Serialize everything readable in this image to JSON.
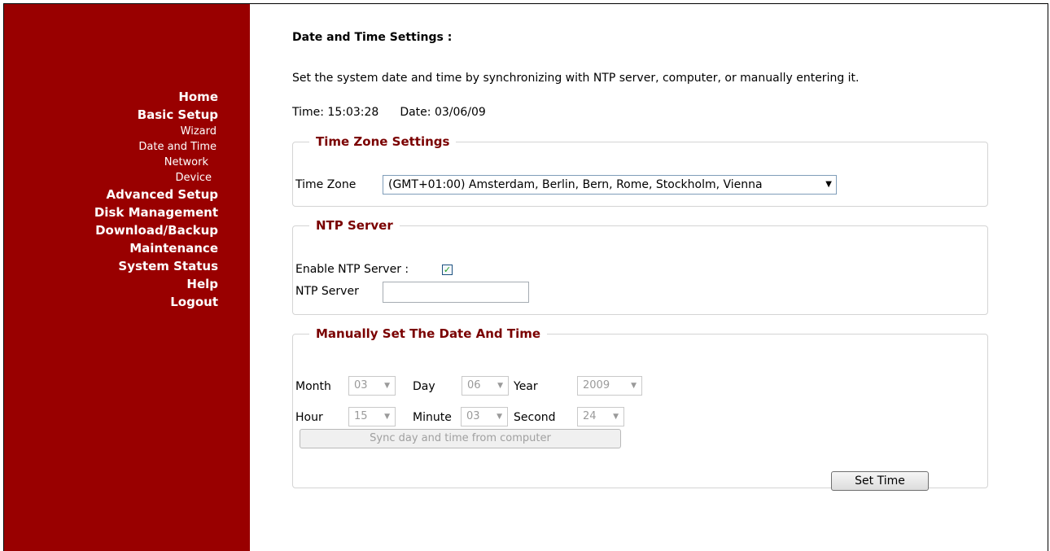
{
  "sidebar": {
    "items": [
      {
        "label": "Home",
        "type": "main"
      },
      {
        "label": "Basic Setup",
        "type": "main"
      },
      {
        "label": "Wizard",
        "type": "sub"
      },
      {
        "label": "Date and Time",
        "type": "sub"
      },
      {
        "label": "Network",
        "type": "sub"
      },
      {
        "label": "Device",
        "type": "sub"
      },
      {
        "label": "Advanced Setup",
        "type": "main"
      },
      {
        "label": "Disk Management",
        "type": "main"
      },
      {
        "label": "Download/Backup",
        "type": "main"
      },
      {
        "label": "Maintenance",
        "type": "main"
      },
      {
        "label": "System Status",
        "type": "main"
      },
      {
        "label": "Help",
        "type": "main"
      },
      {
        "label": "Logout",
        "type": "main"
      }
    ]
  },
  "page": {
    "title": "Date and Time Settings :",
    "description": "Set the system date and time by synchronizing with NTP server, computer, or manually entering it.",
    "time_label": "Time: 15:03:28",
    "date_label": "Date: 03/06/09"
  },
  "timezone": {
    "legend": "Time Zone Settings",
    "label": "Time Zone",
    "value": "(GMT+01:00) Amsterdam, Berlin, Bern, Rome, Stockholm, Vienna"
  },
  "ntp": {
    "legend": "NTP Server",
    "enable_label": "Enable NTP Server :",
    "enabled": true,
    "server_label": "NTP Server",
    "server_value": ""
  },
  "manual": {
    "legend": "Manually Set The Date And Time",
    "month_label": "Month",
    "month": "03",
    "day_label": "Day",
    "day": "06",
    "year_label": "Year",
    "year": "2009",
    "hour_label": "Hour",
    "hour": "15",
    "minute_label": "Minute",
    "minute": "03",
    "second_label": "Second",
    "second": "24",
    "sync_button": "Sync day and time from computer",
    "set_button": "Set Time"
  },
  "colors": {
    "sidebar_bg": "#990000",
    "legend": "#7a0000"
  }
}
